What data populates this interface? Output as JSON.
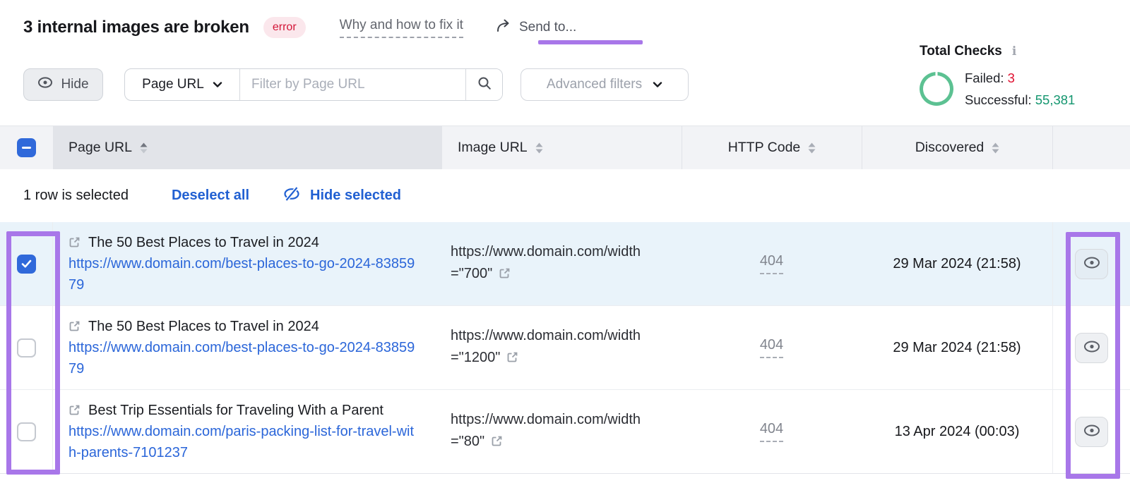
{
  "colors": {
    "annotation_purple": "#a877e9",
    "error_red": "#d31537",
    "success_green": "#5cc192",
    "link_blue": "#2b66d9",
    "selection_blue": "#2160d2",
    "checkbox_blue": "#3069da",
    "selected_row_bg": "#e9f3fa"
  },
  "icons": {
    "info_glyph": "i"
  },
  "header": {
    "title": "3 internal images are broken",
    "badge": "error",
    "why_link": "Why and how to fix it",
    "send_to": "Send to..."
  },
  "total_checks": {
    "title": "Total Checks",
    "failed_label": "Failed:",
    "failed_value": "3",
    "successful_label": "Successful:",
    "successful_value": "55,381"
  },
  "filters": {
    "hide_label": "Hide",
    "field_label": "Page URL",
    "search_placeholder": "Filter by Page URL",
    "search_value": "",
    "advanced_label": "Advanced filters"
  },
  "table": {
    "columns": [
      "Page URL",
      "Image URL",
      "HTTP Code",
      "Discovered"
    ],
    "sort_column": "Page URL",
    "sort_direction": "asc",
    "selection": {
      "count_text": "1 row is selected",
      "deselect_label": "Deselect all",
      "hide_selected_label": "Hide selected"
    },
    "rows": [
      {
        "selected": true,
        "page_title": "The 50 Best Places to Travel in 2024",
        "page_url": "https://www.domain.com/best-places-to-go-2024-8385979",
        "image_url": "https://www.domain.com/width=\"700\"",
        "http_code": "404",
        "discovered": "29 Mar 2024 (21:58)"
      },
      {
        "selected": false,
        "page_title": "The 50 Best Places to Travel in 2024",
        "page_url": "https://www.domain.com/best-places-to-go-2024-8385979",
        "image_url": "https://www.domain.com/width=\"1200\"",
        "http_code": "404",
        "discovered": "29 Mar 2024 (21:58)"
      },
      {
        "selected": false,
        "page_title": "Best Trip Essentials for Traveling With a Parent",
        "page_url": "https://www.domain.com/paris-packing-list-for-travel-with-parents-7101237",
        "image_url": "https://www.domain.com/width=\"80\"",
        "http_code": "404",
        "discovered": "13 Apr 2024 (00:03)"
      }
    ]
  }
}
